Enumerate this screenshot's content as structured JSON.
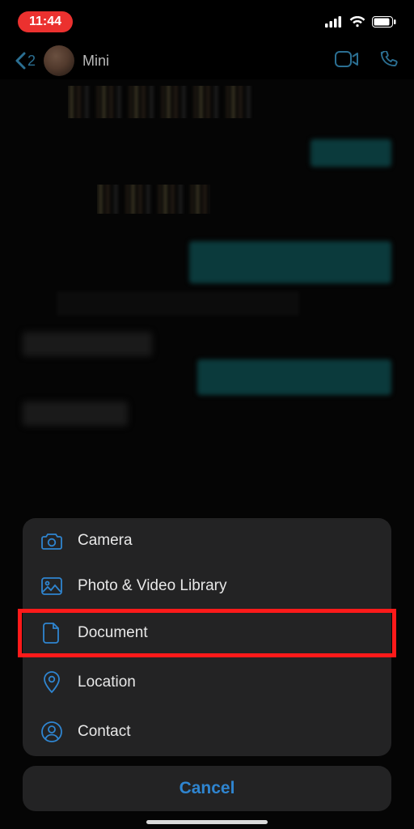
{
  "status": {
    "time": "11:44"
  },
  "header": {
    "back_count": "2",
    "contact_name": "Mini"
  },
  "menu": {
    "items": [
      {
        "label": "Camera"
      },
      {
        "label": "Photo & Video Library"
      },
      {
        "label": "Document"
      },
      {
        "label": "Location"
      },
      {
        "label": "Contact"
      }
    ],
    "cancel_label": "Cancel"
  }
}
